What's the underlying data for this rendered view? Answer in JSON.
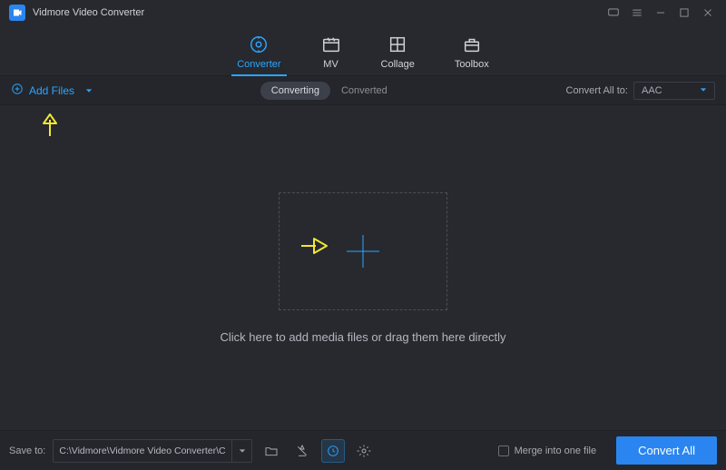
{
  "app": {
    "title": "Vidmore Video Converter"
  },
  "tabs": [
    {
      "label": "Converter",
      "active": true
    },
    {
      "label": "MV",
      "active": false
    },
    {
      "label": "Collage",
      "active": false
    },
    {
      "label": "Toolbox",
      "active": false
    }
  ],
  "subbar": {
    "add_files": "Add Files",
    "segments": {
      "converting": "Converting",
      "converted": "Converted"
    },
    "convert_all_to_label": "Convert All to:",
    "format_selected": "AAC"
  },
  "dropzone": {
    "hint": "Click here to add media files or drag them here directly"
  },
  "bottom": {
    "save_to_label": "Save to:",
    "save_path": "C:\\Vidmore\\Vidmore Video Converter\\Converted",
    "merge_label": "Merge into one file",
    "convert_button": "Convert All"
  }
}
